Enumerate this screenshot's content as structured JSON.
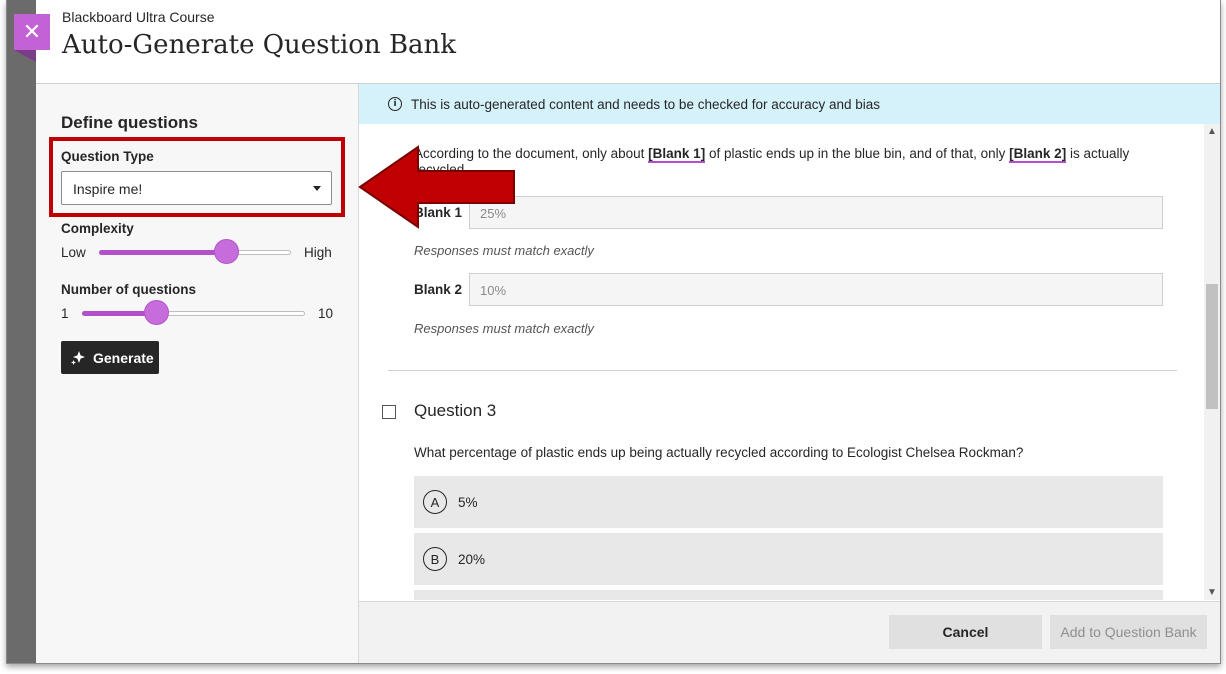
{
  "header": {
    "course_name": "Blackboard Ultra Course",
    "title": "Auto-Generate Question Bank",
    "close_icon": "close-icon"
  },
  "sidebar": {
    "title": "Define questions",
    "question_type_label": "Question Type",
    "question_type_value": "Inspire me!",
    "complexity_label": "Complexity",
    "complexity_low": "Low",
    "complexity_high": "High",
    "complexity_level": 0.66,
    "number_label": "Number of questions",
    "number_min": "1",
    "number_max": "10",
    "number_level": 0.33,
    "generate_label": "Generate",
    "generate_icon": "sparkle-icon"
  },
  "banner": {
    "icon": "info-icon",
    "text": "This is auto-generated content and needs to be checked for accuracy and bias"
  },
  "question2": {
    "text_start": "According to the document, only about",
    "blank1_ref": "[Blank 1]",
    "text_mid": "of plastic ends up in the blue bin, and of that, only",
    "blank2_ref": "[Blank 2]",
    "text_end": "is actually recycled.",
    "blank1_label": "Blank 1",
    "blank1_value": "25%",
    "blank2_label": "Blank 2",
    "blank2_value": "10%",
    "match_note": "Responses must match exactly"
  },
  "question3": {
    "title": "Question 3",
    "text": "What percentage of plastic ends up being actually recycled according to Ecologist Chelsea Rockman?",
    "options": [
      {
        "letter": "A",
        "text": "5%"
      },
      {
        "letter": "B",
        "text": "20%"
      }
    ]
  },
  "footer": {
    "cancel_label": "Cancel",
    "add_label": "Add to Question Bank"
  },
  "colors": {
    "accent": "#c361d6",
    "annotation": "#c00000",
    "banner": "#d5f1fa"
  }
}
